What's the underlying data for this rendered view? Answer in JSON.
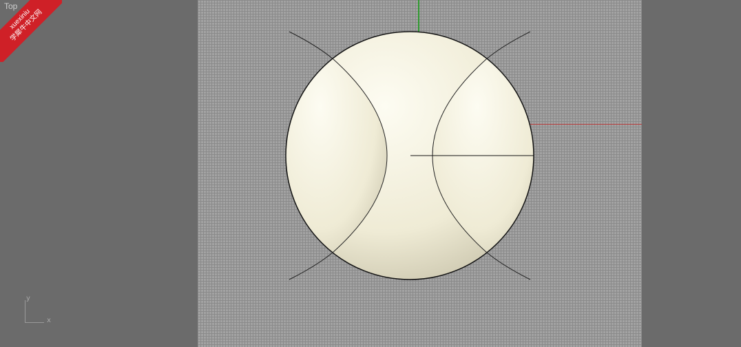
{
  "viewport": {
    "title": "Top"
  },
  "watermark": {
    "line1": "xuexiniu",
    "line2": "学犀牛中文网"
  },
  "axis_icon": {
    "x_label": "x",
    "y_label": "y"
  },
  "colors": {
    "background": "#6b6b6b",
    "grid": "#a3a3a3",
    "sphere_band": "#b8bcf0",
    "sphere_cap": "#f4f1dd",
    "x_axis": "#b63a3a",
    "y_axis": "#2f9a2f"
  }
}
